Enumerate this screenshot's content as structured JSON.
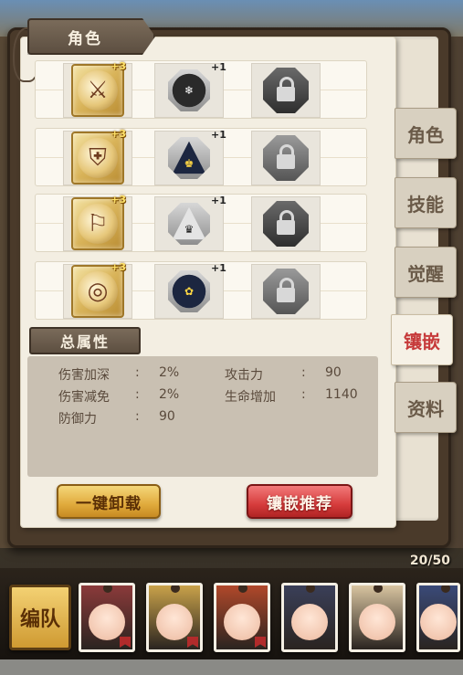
{
  "panel": {
    "title": "角色"
  },
  "slots": [
    {
      "equip_icon": "sword-icon",
      "equip_glyph": "⚔",
      "equip_plus": "+3",
      "gem_icon": "snowflake-gem-icon",
      "gem_glyph": "❄",
      "gem_plus": "+1",
      "lock_icon": "lock-icon"
    },
    {
      "equip_icon": "armor-icon",
      "equip_glyph": "⛨",
      "equip_plus": "+3",
      "gem_icon": "bell-gem-icon",
      "gem_glyph": "♚",
      "gem_plus": "+1",
      "lock_icon": "lock-icon"
    },
    {
      "equip_icon": "boots-icon",
      "equip_glyph": "⚐",
      "equip_plus": "+3",
      "gem_icon": "crown-gem-icon",
      "gem_glyph": "♛",
      "gem_plus": "+1",
      "lock_icon": "lock-icon"
    },
    {
      "equip_icon": "ring-icon",
      "equip_glyph": "◎",
      "equip_plus": "+3",
      "gem_icon": "flower-gem-icon",
      "gem_glyph": "✿",
      "gem_plus": "+1",
      "lock_icon": "lock-icon"
    }
  ],
  "attributes": {
    "title": "总属性",
    "items": [
      {
        "name": "伤害加深",
        "colon": ":",
        "value": "2%"
      },
      {
        "name": "攻击力",
        "colon": ":",
        "value": "90"
      },
      {
        "name": "伤害减免",
        "colon": ":",
        "value": "2%"
      },
      {
        "name": "生命增加",
        "colon": ":",
        "value": "1140"
      },
      {
        "name": "防御力",
        "colon": ":",
        "value": "90"
      }
    ]
  },
  "buttons": {
    "unequip_all": "一键卸载",
    "recommend": "镶嵌推荐"
  },
  "tabs": [
    {
      "label": "角色",
      "active": false
    },
    {
      "label": "技能",
      "active": false
    },
    {
      "label": "觉醒",
      "active": false
    },
    {
      "label": "镶嵌",
      "active": true
    },
    {
      "label": "资料",
      "active": false
    }
  ],
  "team": {
    "count": "20/50",
    "button_label": "编队",
    "portrait_colors": [
      "#8b3a3a",
      "#c9a24a",
      "#b0482a",
      "#3a3f58",
      "#d8c4a0",
      "#3a4a78"
    ]
  },
  "colors": {
    "accent_red": "#c63a3a",
    "gold": "#e0aa3c"
  }
}
